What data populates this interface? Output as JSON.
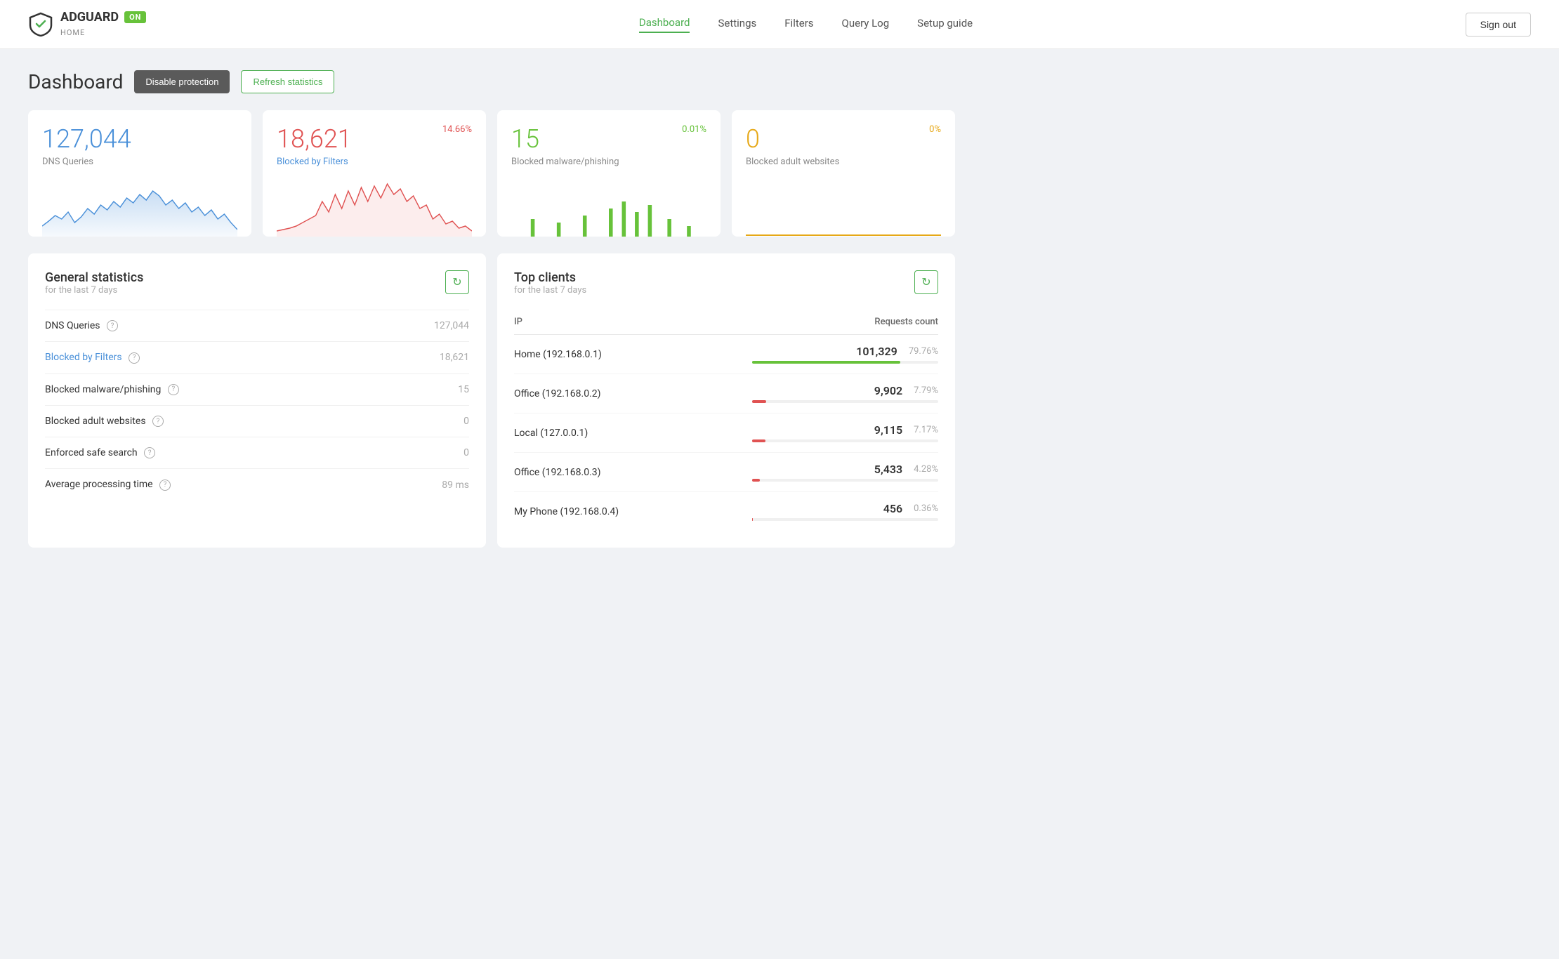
{
  "brand": {
    "name": "ADGUARD",
    "sub": "HOME",
    "badge": "ON"
  },
  "nav": {
    "links": [
      {
        "label": "Dashboard",
        "active": true
      },
      {
        "label": "Settings",
        "active": false
      },
      {
        "label": "Filters",
        "active": false
      },
      {
        "label": "Query Log",
        "active": false
      },
      {
        "label": "Setup guide",
        "active": false
      }
    ],
    "sign_out": "Sign out"
  },
  "dashboard": {
    "title": "Dashboard",
    "disable_btn": "Disable protection",
    "refresh_btn": "Refresh statistics"
  },
  "stat_cards": [
    {
      "value": "127,044",
      "label": "DNS Queries",
      "color": "blue",
      "percent": "",
      "percent_color": ""
    },
    {
      "value": "18,621",
      "label": "Blocked by Filters",
      "color": "red",
      "percent": "14.66%",
      "percent_color": "red"
    },
    {
      "value": "15",
      "label": "Blocked malware/phishing",
      "color": "green",
      "percent": "0.01%",
      "percent_color": "green"
    },
    {
      "value": "0",
      "label": "Blocked adult websites",
      "color": "yellow",
      "percent": "0%",
      "percent_color": "yellow"
    }
  ],
  "general_stats": {
    "title": "General statistics",
    "subtitle": "for the last 7 days",
    "rows": [
      {
        "label": "DNS Queries",
        "value": "127,044",
        "link": false
      },
      {
        "label": "Blocked by Filters",
        "value": "18,621",
        "link": true
      },
      {
        "label": "Blocked malware/phishing",
        "value": "15",
        "link": false
      },
      {
        "label": "Blocked adult websites",
        "value": "0",
        "link": false
      },
      {
        "label": "Enforced safe search",
        "value": "0",
        "link": false
      },
      {
        "label": "Average processing time",
        "value": "89 ms",
        "link": false
      }
    ]
  },
  "top_clients": {
    "title": "Top clients",
    "subtitle": "for the last 7 days",
    "col_ip": "IP",
    "col_requests": "Requests count",
    "rows": [
      {
        "name": "Home (192.168.0.1)",
        "value": "101,329",
        "percent": "79.76%",
        "bar": 79.76,
        "bar_color": "green"
      },
      {
        "name": "Office (192.168.0.2)",
        "value": "9,902",
        "percent": "7.79%",
        "bar": 7.79,
        "bar_color": "red"
      },
      {
        "name": "Local (127.0.0.1)",
        "value": "9,115",
        "percent": "7.17%",
        "bar": 7.17,
        "bar_color": "red"
      },
      {
        "name": "Office (192.168.0.3)",
        "value": "5,433",
        "percent": "4.28%",
        "bar": 4.28,
        "bar_color": "red"
      },
      {
        "name": "My Phone (192.168.0.4)",
        "value": "456",
        "percent": "0.36%",
        "bar": 0.36,
        "bar_color": "red"
      }
    ]
  }
}
